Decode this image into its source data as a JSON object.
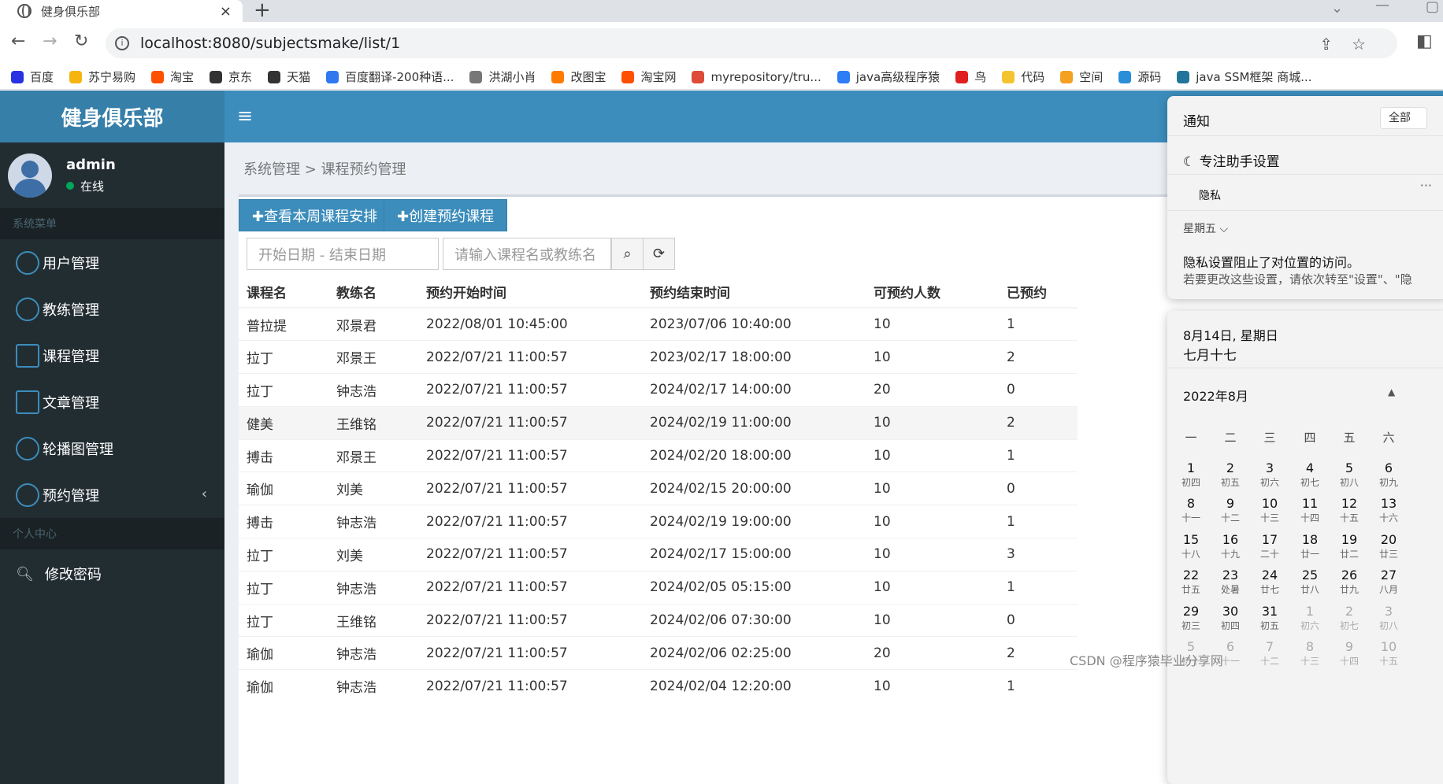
{
  "browser": {
    "tab_title": "健身俱乐部",
    "tab_close": "×",
    "new_tab": "+",
    "url": "localhost:8080/subjectsmake/list/1",
    "bookmarks": [
      "百度",
      "苏宁易购",
      "淘宝",
      "京东",
      "天猫",
      "百度翻译-200种语...",
      "洪湖小肖",
      "改图宝",
      "淘宝网",
      "myrepository/tru...",
      "java高级程序猿",
      "鸟",
      "代码",
      "空间",
      "源码",
      "java SSM框架 商城..."
    ],
    "bookmark_colors": [
      "#2932e1",
      "#f6b40e",
      "#ff5000",
      "#333333",
      "#333333",
      "#2f78f0",
      "#777777",
      "#ff7b00",
      "#ff5000",
      "#dd4b39",
      "#2e7cf6",
      "#e02020",
      "#f4c430",
      "#f4a020",
      "#2a8fd6",
      "#21759b"
    ]
  },
  "sidebar": {
    "brand": "健身俱乐部",
    "user": {
      "name": "admin",
      "status": "在线"
    },
    "section_system": "系统菜单",
    "items": [
      {
        "label": "用户管理",
        "icon": "user-icon"
      },
      {
        "label": "教练管理",
        "icon": "coach-icon"
      },
      {
        "label": "课程管理",
        "icon": "calendar-icon"
      },
      {
        "label": "文章管理",
        "icon": "document-icon"
      },
      {
        "label": "轮播图管理",
        "icon": "carousel-icon"
      },
      {
        "label": "预约管理",
        "icon": "clock-icon"
      }
    ],
    "section_personal": "个人中心",
    "change_password": "修改密码"
  },
  "topbar": {
    "menu_icon": "≡"
  },
  "breadcrumb": "系统管理 > 课程预约管理",
  "actions": {
    "view_week": "✚查看本周课程安排",
    "create": "✚创建预约课程",
    "date_placeholder": "开始日期  - 结束日期",
    "search_placeholder": "请输入课程名或教练名"
  },
  "table": {
    "headers": [
      "课程名",
      "教练名",
      "预约开始时间",
      "预约结束时间",
      "可预约人数",
      "已预约"
    ],
    "rows": [
      [
        "普拉提",
        "邓景君",
        "2022/08/01 10:45:00",
        "2023/07/06 10:40:00",
        "10",
        "1"
      ],
      [
        "拉丁",
        "邓景王",
        "2022/07/21 11:00:57",
        "2023/02/17 18:00:00",
        "10",
        "2"
      ],
      [
        "拉丁",
        "钟志浩",
        "2022/07/21 11:00:57",
        "2024/02/17 14:00:00",
        "20",
        "0"
      ],
      [
        "健美",
        "王维铭",
        "2022/07/21 11:00:57",
        "2024/02/19 11:00:00",
        "10",
        "2"
      ],
      [
        "搏击",
        "邓景王",
        "2022/07/21 11:00:57",
        "2024/02/20 18:00:00",
        "10",
        "1"
      ],
      [
        "瑜伽",
        "刘美",
        "2022/07/21 11:00:57",
        "2024/02/15 20:00:00",
        "10",
        "0"
      ],
      [
        "搏击",
        "钟志浩",
        "2022/07/21 11:00:57",
        "2024/02/19 19:00:00",
        "10",
        "1"
      ],
      [
        "拉丁",
        "刘美",
        "2022/07/21 11:00:57",
        "2024/02/17 15:00:00",
        "10",
        "3"
      ],
      [
        "拉丁",
        "钟志浩",
        "2022/07/21 11:00:57",
        "2024/02/05 05:15:00",
        "10",
        "1"
      ],
      [
        "拉丁",
        "王维铭",
        "2022/07/21 11:00:57",
        "2024/02/06 07:30:00",
        "10",
        "0"
      ],
      [
        "瑜伽",
        "钟志浩",
        "2022/07/21 11:00:57",
        "2024/02/06 02:25:00",
        "20",
        "2"
      ],
      [
        "瑜伽",
        "钟志浩",
        "2022/07/21 11:00:57",
        "2024/02/04 12:20:00",
        "10",
        "1"
      ]
    ]
  },
  "notification_panel": {
    "title": "通知",
    "clear_all": "全部",
    "focus_assist": "专注助手设置",
    "privacy": "隐私",
    "more": "···",
    "day": "星期五",
    "message_title": "隐私设置阻止了对位置的访问。",
    "message_body": "若要更改这些设置，请依次转至\"设置\"、\"隐"
  },
  "calendar": {
    "date": "8月14日, 星期日",
    "lunar": "七月十七",
    "month": "2022年8月",
    "weekdays": [
      "一",
      "二",
      "三",
      "四",
      "五",
      "六"
    ],
    "weeks": [
      [
        [
          "1",
          "初四"
        ],
        [
          "2",
          "初五"
        ],
        [
          "3",
          "初六"
        ],
        [
          "4",
          "初七"
        ],
        [
          "5",
          "初八"
        ],
        [
          "6",
          "初九"
        ]
      ],
      [
        [
          "8",
          "十一"
        ],
        [
          "9",
          "十二"
        ],
        [
          "10",
          "十三"
        ],
        [
          "11",
          "十四"
        ],
        [
          "12",
          "十五"
        ],
        [
          "13",
          "十六"
        ]
      ],
      [
        [
          "15",
          "十八"
        ],
        [
          "16",
          "十九"
        ],
        [
          "17",
          "二十"
        ],
        [
          "18",
          "廿一"
        ],
        [
          "19",
          "廿二"
        ],
        [
          "20",
          "廿三"
        ]
      ],
      [
        [
          "22",
          "廿五"
        ],
        [
          "23",
          "处暑"
        ],
        [
          "24",
          "廿七"
        ],
        [
          "25",
          "廿八"
        ],
        [
          "26",
          "廿九"
        ],
        [
          "27",
          "八月"
        ]
      ],
      [
        [
          "29",
          "初三"
        ],
        [
          "30",
          "初四"
        ],
        [
          "31",
          "初五"
        ],
        [
          "1",
          "初六"
        ],
        [
          "2",
          "初七"
        ],
        [
          "3",
          "初八"
        ]
      ],
      [
        [
          "5",
          "初十"
        ],
        [
          "6",
          "十一"
        ],
        [
          "7",
          "十二"
        ],
        [
          "8",
          "十三"
        ],
        [
          "9",
          "十四"
        ],
        [
          "10",
          "十五"
        ]
      ]
    ]
  },
  "watermark": "CSDN @程序猿毕业分享网"
}
